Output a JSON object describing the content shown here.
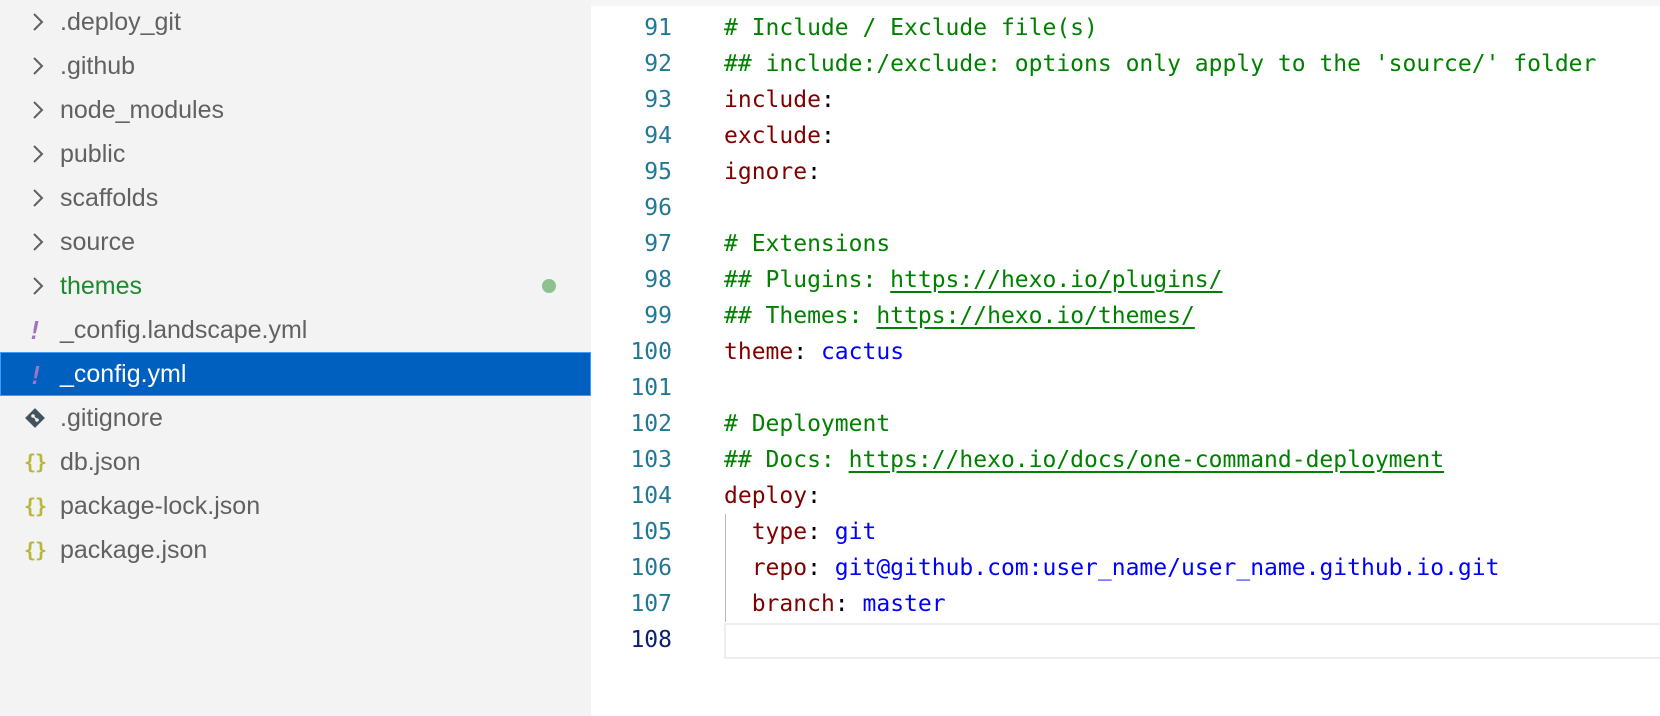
{
  "explorer": {
    "items": [
      {
        "label": ".deploy_git",
        "type": "folder",
        "icon": "chevron-right-icon"
      },
      {
        "label": ".github",
        "type": "folder",
        "icon": "chevron-right-icon"
      },
      {
        "label": "node_modules",
        "type": "folder",
        "icon": "chevron-right-icon"
      },
      {
        "label": "public",
        "type": "folder",
        "icon": "chevron-right-icon"
      },
      {
        "label": "scaffolds",
        "type": "folder",
        "icon": "chevron-right-icon"
      },
      {
        "label": "source",
        "type": "folder",
        "icon": "chevron-right-icon"
      },
      {
        "label": "themes",
        "type": "folder",
        "icon": "chevron-right-icon",
        "status": "modified"
      },
      {
        "label": "_config.landscape.yml",
        "type": "file",
        "icon": "yaml-file-icon",
        "glyph": "!"
      },
      {
        "label": "_config.yml",
        "type": "file",
        "icon": "yaml-file-icon",
        "glyph": "!",
        "selected": true
      },
      {
        "label": ".gitignore",
        "type": "file",
        "icon": "git-file-icon"
      },
      {
        "label": "db.json",
        "type": "file",
        "icon": "json-file-icon",
        "glyph": "{}"
      },
      {
        "label": "package-lock.json",
        "type": "file",
        "icon": "json-file-icon",
        "glyph": "{}"
      },
      {
        "label": "package.json",
        "type": "file",
        "icon": "json-file-icon",
        "glyph": "{}"
      }
    ]
  },
  "editor": {
    "current_line": "108",
    "lines": [
      {
        "num": "91",
        "comment": "# Include / Exclude file(s)"
      },
      {
        "num": "92",
        "comment": "## include:/exclude: options only apply to the 'source/' folder"
      },
      {
        "num": "93",
        "key": "include",
        "colon": ":"
      },
      {
        "num": "94",
        "key": "exclude",
        "colon": ":"
      },
      {
        "num": "95",
        "key": "ignore",
        "colon": ":"
      },
      {
        "num": "96"
      },
      {
        "num": "97",
        "comment": "# Extensions"
      },
      {
        "num": "98",
        "comment": "## Plugins: ",
        "link": "https://hexo.io/plugins/"
      },
      {
        "num": "99",
        "comment": "## Themes: ",
        "link": "https://hexo.io/themes/"
      },
      {
        "num": "100",
        "key": "theme",
        "colon": ": ",
        "value": "cactus"
      },
      {
        "num": "101"
      },
      {
        "num": "102",
        "comment": "# Deployment"
      },
      {
        "num": "103",
        "comment": "## Docs: ",
        "link": "https://hexo.io/docs/one-command-deployment"
      },
      {
        "num": "104",
        "key": "deploy",
        "colon": ":"
      },
      {
        "num": "105",
        "indent": "  ",
        "key": "type",
        "colon": ": ",
        "value": "git"
      },
      {
        "num": "106",
        "indent": "  ",
        "key": "repo",
        "colon": ": ",
        "value": "git@github.com:user_name/user_name.github.io.git"
      },
      {
        "num": "107",
        "indent": "  ",
        "key": "branch",
        "colon": ": ",
        "value": "master"
      },
      {
        "num": "108"
      }
    ]
  },
  "colors": {
    "sidebar_bg": "#f3f3f3",
    "selection_bg": "#0060c0",
    "modified_text": "#1e8a2f",
    "comment": "#008000",
    "yaml_key": "#800000",
    "yaml_value": "#0000ff",
    "line_number": "#237893"
  }
}
